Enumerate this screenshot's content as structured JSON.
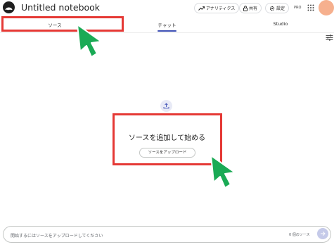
{
  "header": {
    "logo_icon": "notebooklm-logo-icon",
    "title": "Untitled notebook",
    "buttons": [
      {
        "label": "アナリティクス",
        "icon": "trending-up-icon"
      },
      {
        "label": "共有",
        "icon": "lock-icon"
      },
      {
        "label": "設定",
        "icon": "gear-icon"
      }
    ],
    "pro_label": "PRO",
    "apps_icon": "apps-grid-icon",
    "avatar_color": "#f6b08e"
  },
  "tabs": [
    {
      "label": "ソース",
      "active": false
    },
    {
      "label": "チャット",
      "active": true
    },
    {
      "label": "Studio",
      "active": false
    }
  ],
  "empty_state": {
    "icon": "upload-icon",
    "title": "ソースを追加して始める",
    "button_label": "ソースをアップロード"
  },
  "chat": {
    "placeholder": "開始するにはソースをアップロードしてください",
    "source_count": "0 個のソース",
    "send_icon": "send-arrow-icon"
  },
  "annotations": {
    "highlight_color": "#e53935",
    "arrow_color": "#1aaa55"
  }
}
